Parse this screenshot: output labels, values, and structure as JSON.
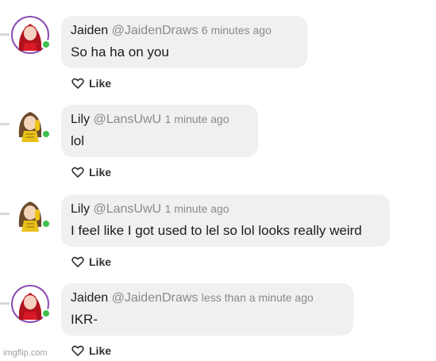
{
  "comments": [
    {
      "author": "Jaiden",
      "handle": "@JaidenDraws",
      "time": "6 minutes ago",
      "text": "So ha ha on you",
      "like_label": "Like",
      "avatar": "red-hair-avatar",
      "online": true
    },
    {
      "author": "Lily",
      "handle": "@LansUwU",
      "time": "1 minute ago",
      "text": "lol",
      "like_label": "Like",
      "avatar": "brown-hair-avatar",
      "online": true
    },
    {
      "author": "Lily",
      "handle": "@LansUwU",
      "time": "1 minute ago",
      "text": "I feel like I got used to lel so lol looks really weird",
      "like_label": "Like",
      "avatar": "brown-hair-avatar",
      "online": true
    },
    {
      "author": "Jaiden",
      "handle": "@JaidenDraws",
      "time": "less than a minute ago",
      "text": "IKR-",
      "like_label": "Like",
      "avatar": "red-hair-avatar",
      "online": true
    }
  ],
  "watermark": "imgflip.com",
  "colors": {
    "bubble": "#f0f0f1",
    "online": "#3fbf4f",
    "muted_text": "#8a8a8a"
  }
}
